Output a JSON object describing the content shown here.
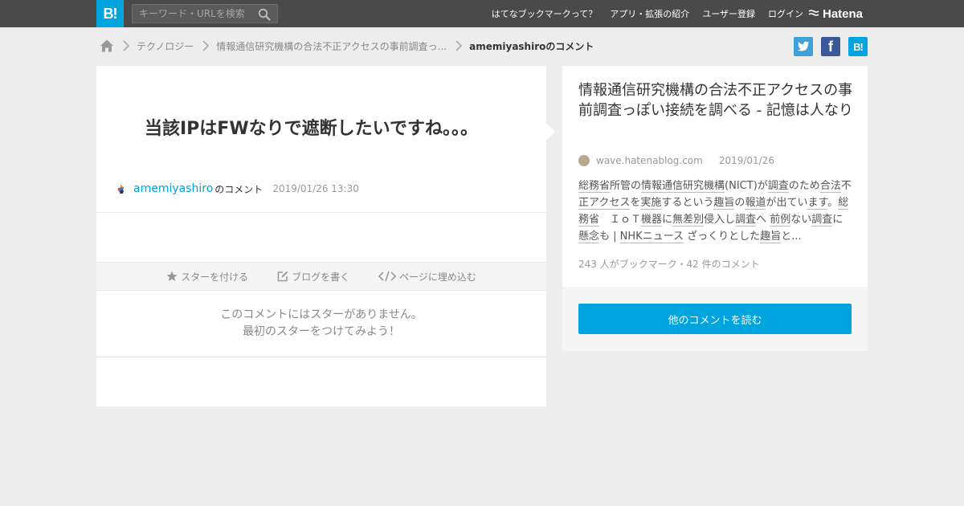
{
  "header": {
    "logo_text": "B!",
    "search_placeholder": "キーワード・URLを検索",
    "nav": [
      "はてなブックマークって？",
      "アプリ・拡張の紹介",
      "ユーザー登録",
      "ログイン"
    ],
    "brand": "Hatena",
    "icons": {
      "search": "search-icon",
      "brand": "hatena-icon"
    }
  },
  "breadcrumb": {
    "items": [
      "テクノロジー",
      "情報通信研究機構の合法不正アクセスの事前調査っ..."
    ],
    "current": "amemiyashiroのコメント"
  },
  "share": {
    "twitter": "twitter-icon",
    "facebook_label": "f",
    "hatena_label": "B!"
  },
  "comment": {
    "text": "当該IPはFWなりで遮断したいですね。。。",
    "username": "amemiyashiro",
    "user_suffix": "のコメント",
    "date": "2019/01/26 13:30"
  },
  "actions": {
    "star": "スターを付ける",
    "blog": "ブログを書く",
    "embed": "ページに埋め込む"
  },
  "nostar": [
    "このコメントにはスターがありません。",
    "最初のスターをつけてみよう！"
  ],
  "entry": {
    "title": "情報通信研究機構の合法不正アクセスの事前調査っぽい接続を調べる - 記憶は人なり",
    "site": "wave.hatenablog.com",
    "date": "2019/01/26",
    "summary_parts": [
      {
        "t": "総務省",
        "u": true
      },
      {
        "t": "所管の",
        "u": false
      },
      {
        "t": "情報通信研究機構",
        "u": true
      },
      {
        "t": "(NICT)が",
        "u": false
      },
      {
        "t": "調査",
        "u": true
      },
      {
        "t": "のため",
        "u": false
      },
      {
        "t": "合法",
        "u": true
      },
      {
        "t": "不",
        "u": false
      },
      {
        "t": "正アクセス",
        "u": true
      },
      {
        "t": "を",
        "u": false
      },
      {
        "t": "実施",
        "u": true
      },
      {
        "t": "するという",
        "u": false
      },
      {
        "t": "趣旨",
        "u": true
      },
      {
        "t": "の",
        "u": false
      },
      {
        "t": "報道",
        "u": true
      },
      {
        "t": "が出てい",
        "u": false
      },
      {
        "t": "ます",
        "u": true
      },
      {
        "t": "。",
        "u": false
      },
      {
        "t": "総務省",
        "u": true
      },
      {
        "t": "　ＩｏＴ",
        "u": false
      },
      {
        "t": "機器",
        "u": true
      },
      {
        "t": "に",
        "u": false
      },
      {
        "t": "無差別",
        "u": true
      },
      {
        "t": "侵入し",
        "u": false
      },
      {
        "t": "調査",
        "u": true
      },
      {
        "t": "へ ",
        "u": false
      },
      {
        "t": "前例",
        "u": true
      },
      {
        "t": "ない",
        "u": false
      },
      {
        "t": "調査",
        "u": true
      },
      {
        "t": "に",
        "u": false
      },
      {
        "t": "懸念",
        "u": true
      },
      {
        "t": "も | ",
        "u": false
      },
      {
        "t": "NHKニュース",
        "u": true
      },
      {
        "t": " ざっくりとした",
        "u": false
      },
      {
        "t": "趣旨",
        "u": true
      },
      {
        "t": "と...",
        "u": false
      }
    ],
    "bookmark_info": "243 人がブックマーク・42 件のコメント"
  },
  "readmore": "他のコメントを読む",
  "colors": {
    "accent": "#00a4de",
    "header_bg": "#4a4a4a",
    "page_bg": "#ededed"
  }
}
